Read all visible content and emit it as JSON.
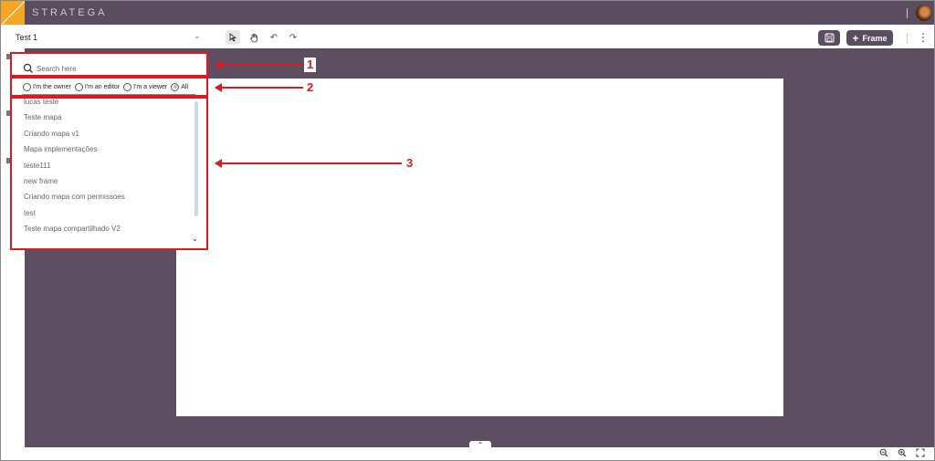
{
  "app": {
    "brand": "STRATEGA"
  },
  "toolbar": {
    "project_name": "Test 1",
    "frame_label": "Frame"
  },
  "search": {
    "placeholder": "Search here"
  },
  "filters": [
    {
      "label": "I'm the owner",
      "checked": false
    },
    {
      "label": "I'm an editor",
      "checked": false
    },
    {
      "label": "I'm a viewer",
      "checked": false
    },
    {
      "label": "All",
      "checked": true
    }
  ],
  "projects": [
    "lucas teste",
    "Teste mapa",
    "Criando mapa v1",
    "Mapa implementações",
    "teste111",
    "new frame",
    "Criando mapa com permissoes",
    "test",
    "Teste mapa compartilhado V2"
  ],
  "annotations": [
    "1",
    "2",
    "3"
  ],
  "colors": {
    "accent": "#5a4d60",
    "canvas": "#5d4e62",
    "logo": "#f5a623",
    "annotation": "#e0191e"
  }
}
